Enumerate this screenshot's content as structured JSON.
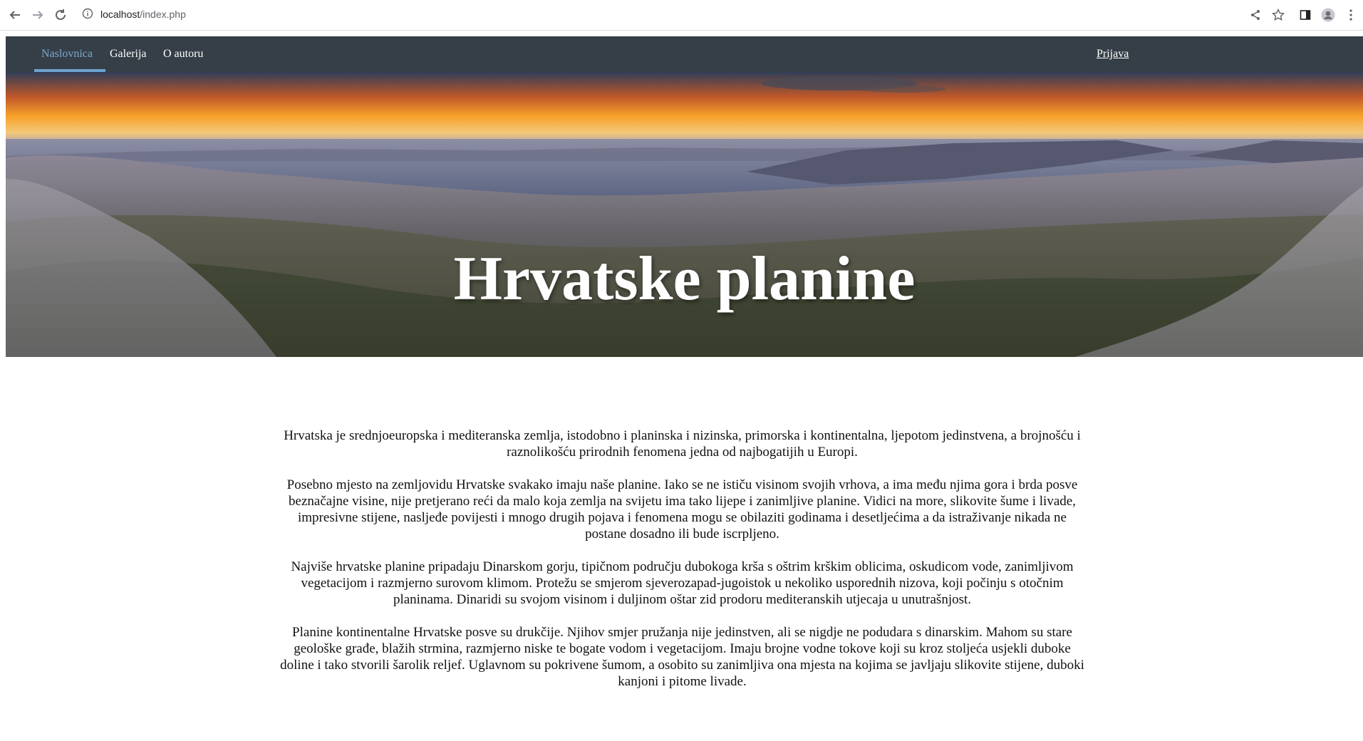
{
  "browser": {
    "url_host": "localhost",
    "url_path": "/index.php"
  },
  "nav": {
    "items": [
      {
        "label": "Naslovnica",
        "active": true
      },
      {
        "label": "Galerija",
        "active": false
      },
      {
        "label": "O autoru",
        "active": false
      }
    ],
    "login": "Prijava"
  },
  "hero": {
    "title": "Hrvatske planine"
  },
  "content": {
    "paragraphs": [
      "Hrvatska je srednjoeuropska i mediteranska zemlja, istodobno i planinska i nizinska, primorska i kontinentalna, ljepotom jedinstvena, a brojnošću i raznolikošću prirodnih fenomena jedna od najbogatijih u Europi.",
      "Posebno mjesto na zemljovidu Hrvatske svakako imaju naše planine. Iako se ne ističu visinom svojih vrhova, a ima među njima gora i brda posve beznačajne visine, nije pretjerano reći da malo koja zemlja na svijetu ima tako lijepe i zanimljive planine. Vidici na more, slikovite šume i livade, impresivne stijene, nasljeđe povijesti i mnogo drugih pojava i fenomena mogu se obilaziti godinama i desetljećima a da istraživanje nikada ne postane dosadno ili bude iscrpljeno.",
      "Najviše hrvatske planine pripadaju Dinarskom gorju, tipičnom području dubokoga krša s oštrim krškim oblicima, oskudicom vode, zanimljivom vegetacijom i razmjerno surovom klimom. Protežu se smjerom sjeverozapad-jugoistok u nekoliko usporednih nizova, koji počinju s otočnim planinama. Dinaridi su svojom visinom i duljinom oštar zid prodoru mediteranskih utjecaja u unutrašnjost.",
      "Planine kontinentalne Hrvatske posve su drukčije. Njihov smjer pružanja nije jedinstven, ali se nigdje ne podudara s dinarskim. Mahom su stare geološke građe, blažih strmina, razmjerno niske te bogate vodom i vegetacijom. Imaju brojne vodne tokove koji su kroz stoljeća usjekli duboke doline i tako stvorili šarolik reljef. Uglavnom su pokrivene šumom, a osobito su zanimljiva ona mjesta na kojima se javljaju slikovite stijene, duboki kanjoni i pitome livade."
    ]
  }
}
